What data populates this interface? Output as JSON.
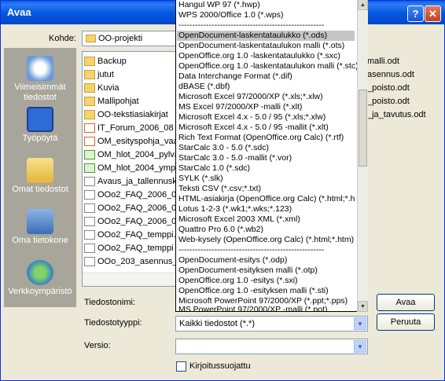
{
  "window": {
    "title": "Avaa",
    "help_btn": "?",
    "close_btn": "✕"
  },
  "location": {
    "label": "Kohde:",
    "value": "OO-projekti"
  },
  "places": [
    {
      "name": "recent",
      "label": "Viimeisimmät tiedostot"
    },
    {
      "name": "desktop",
      "label": "Työpöytä"
    },
    {
      "name": "mydocs",
      "label": "Omat tiedostot"
    },
    {
      "name": "computer",
      "label": "Oma tietokone"
    },
    {
      "name": "network",
      "label": "Verkkoympäristö"
    }
  ],
  "files": [
    {
      "name": "Backup",
      "type": "folder"
    },
    {
      "name": "jutut",
      "type": "folder"
    },
    {
      "name": "Kuvia",
      "type": "folder"
    },
    {
      "name": "Mallipohjat",
      "type": "folder"
    },
    {
      "name": "OO-tekstiasiakirjat",
      "type": "folder"
    },
    {
      "name": "IT_Forum_2006_08",
      "type": "docr"
    },
    {
      "name": "OM_esityspohja_vaa",
      "type": "docr"
    },
    {
      "name": "OM_hlot_2004_pylva",
      "type": "docg"
    },
    {
      "name": "OM_hlot_2004_ympy",
      "type": "docg"
    },
    {
      "name": "Avaus_ja_tallennusk",
      "type": "doc"
    },
    {
      "name": "OOo2_FAQ_2006_05",
      "type": "doc"
    },
    {
      "name": "OOo2_FAQ_2006_05",
      "type": "doc"
    },
    {
      "name": "OOo2_FAQ_2006_05",
      "type": "doc"
    },
    {
      "name": "OOo2_FAQ_temppi.o",
      "type": "doc"
    },
    {
      "name": "OOo2_FAQ_temppi",
      "type": "doc"
    },
    {
      "name": "OOo_203_asennus_o",
      "type": "doc"
    }
  ],
  "files_right": [
    "malli.odt",
    "asennus.odt",
    "_poisto.odt",
    "_poisto.odt",
    "_ja_tavutus.odt"
  ],
  "filename": {
    "label": "Tiedostonimi:",
    "value": ""
  },
  "filetype": {
    "label": "Tiedostotyyppi:",
    "value": "Kaikki tiedostot (*.*)"
  },
  "version": {
    "label": "Versio:",
    "value": ""
  },
  "readonly": {
    "label": "Kirjoitussuojattu"
  },
  "buttons": {
    "open": "Avaa",
    "cancel": "Peruuta"
  },
  "dropdown": [
    {
      "text": "Hangul WP 97 (*.hwp)"
    },
    {
      "text": "WPS 2000/Office 1.0 (*.wps)"
    },
    {
      "text": "-----------------------------------------------------"
    },
    {
      "text": "OpenDocument-laskentataulukko (*.ods)",
      "selected": true
    },
    {
      "text": "OpenDocument-laskentataulukon malli (*.ots)"
    },
    {
      "text": "OpenOffice.org 1.0 -laskentataulukko (*.sxc)"
    },
    {
      "text": "OpenOffice.org 1.0 -laskentataulukon malli (*.stc)"
    },
    {
      "text": "Data Interchange Format (*.dif)"
    },
    {
      "text": "dBASE (*.dbf)"
    },
    {
      "text": "Microsoft Excel 97/2000/XP (*.xls;*.xlw)"
    },
    {
      "text": "MS Excel 97/2000/XP -malli (*.xlt)"
    },
    {
      "text": "Microsoft Excel 4.x - 5.0 / 95 (*.xls;*.xlw)"
    },
    {
      "text": "Microsoft Excel 4.x - 5.0 / 95 -mallit (*.xlt)"
    },
    {
      "text": "Rich Text Format (OpenOffice.org Calc) (*.rtf)"
    },
    {
      "text": "StarCalc 3.0 - 5.0 (*.sdc)"
    },
    {
      "text": "StarCalc 3.0 - 5.0 -mallit (*.vor)"
    },
    {
      "text": "StarCalc 1.0 (*.sdc)"
    },
    {
      "text": "SYLK (*.slk)"
    },
    {
      "text": "Teksti CSV (*.csv;*.txt)"
    },
    {
      "text": "HTML-asiakirja (OpenOffice.org Calc) (*.html;*.h"
    },
    {
      "text": "Lotus 1-2-3 (*.wk1;*.wks;*.123)"
    },
    {
      "text": "Microsoft Excel 2003 XML (*.xml)"
    },
    {
      "text": "Quattro Pro 6.0 (*.wb2)"
    },
    {
      "text": "Web-kysely (OpenOffice.org Calc) (*.html;*.htm)"
    },
    {
      "text": "-----------------------------------------------------"
    },
    {
      "text": "OpenDocument-esitys (*.odp)"
    },
    {
      "text": "OpenDocument-esityksen malli (*.otp)"
    },
    {
      "text": "OpenOffice.org 1.0 -esitys (*.sxi)"
    },
    {
      "text": "OpenOffice.org 1.0 -esityksen malli (*.sti)"
    },
    {
      "text": "Microsoft PowerPoint 97/2000/XP (*.ppt;*.pps)"
    },
    {
      "text": "MS PowerPoint 97/2000/XP -malli (*.pot)"
    }
  ],
  "colors": {
    "title_bar": "#0658e3",
    "places_bg": "#a8a59b",
    "selected_item": "#c5c5c5"
  }
}
